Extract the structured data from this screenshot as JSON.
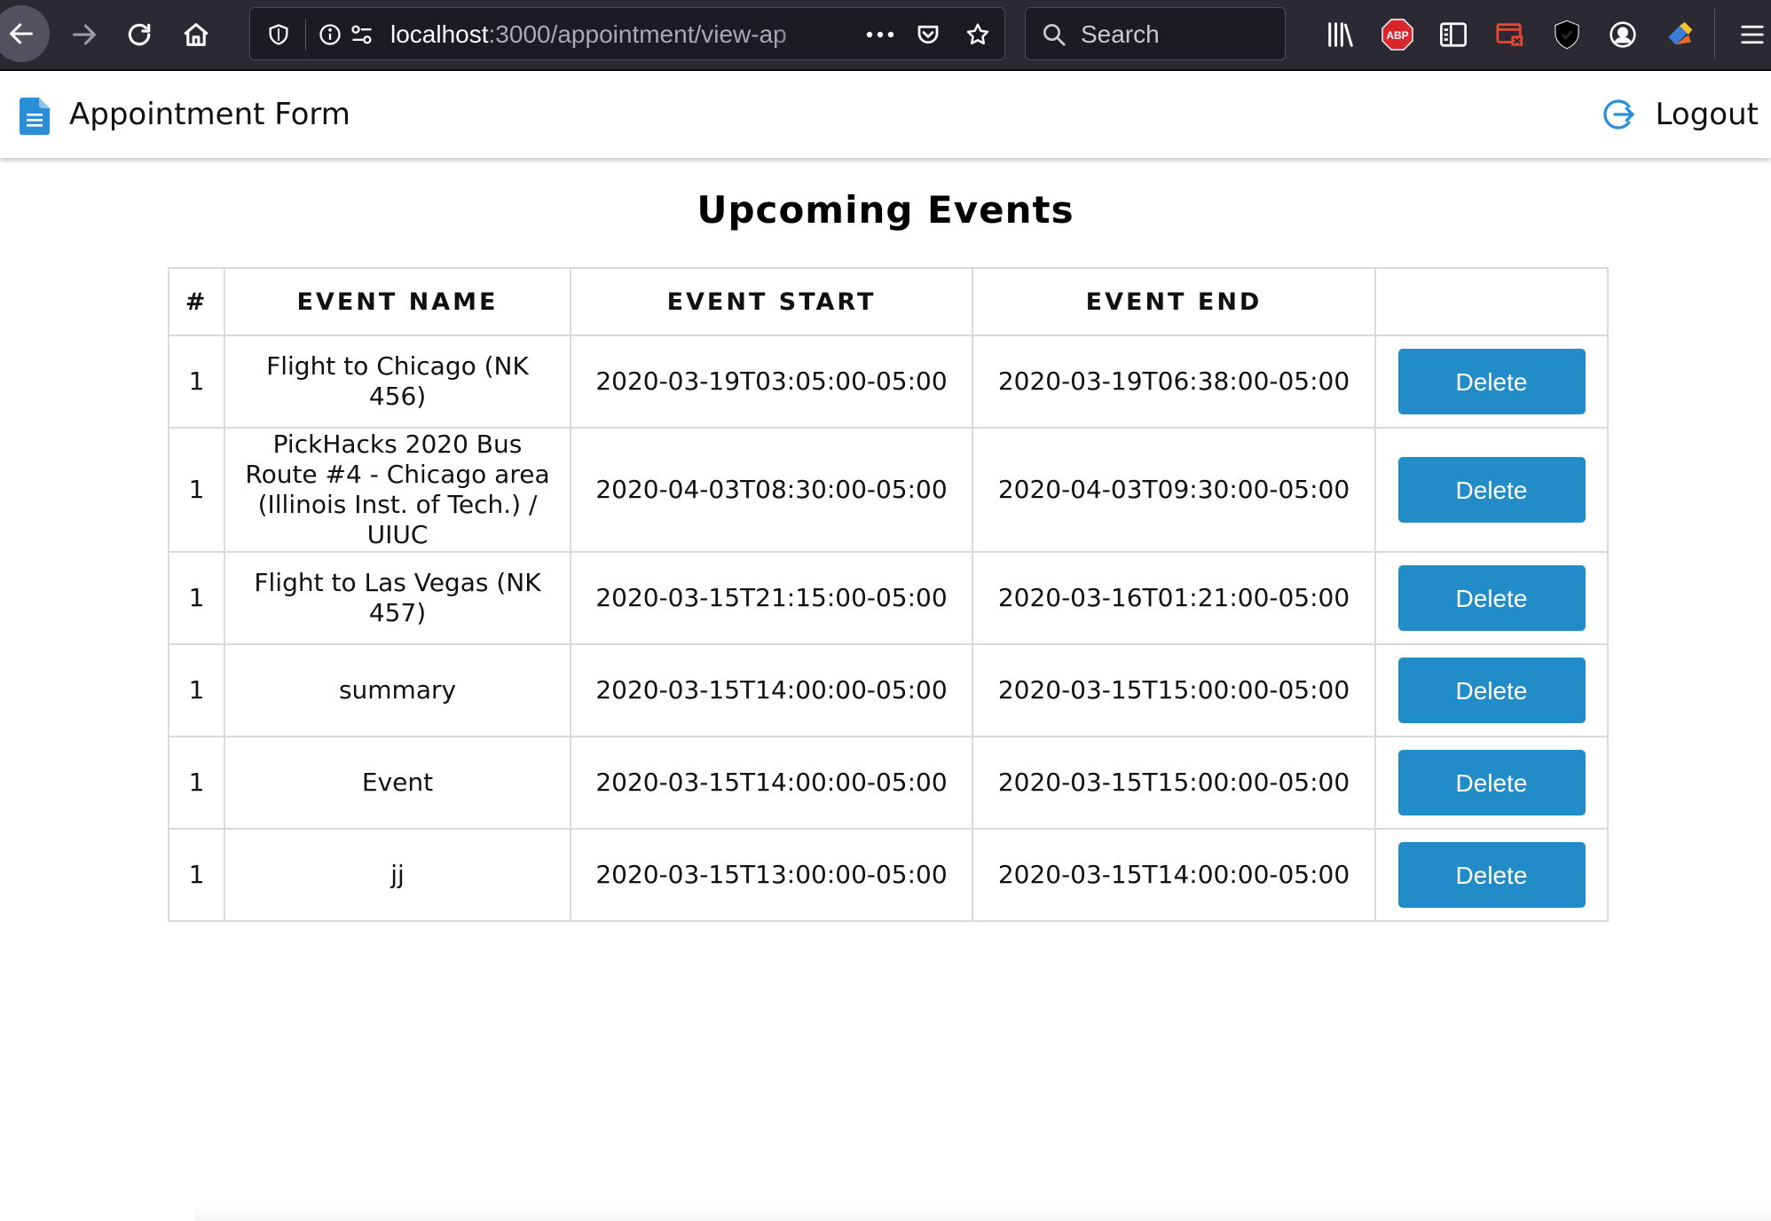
{
  "browser": {
    "url_host": "localhost",
    "url_path": ":3000/appointment/view-ap",
    "search_placeholder": "Search",
    "icons": [
      "back-arrow-icon",
      "forward-arrow-icon",
      "reload-icon",
      "home-icon",
      "shield-icon",
      "info-icon",
      "permissions-icon",
      "more-icon",
      "pocket-icon",
      "star-icon",
      "search-icon",
      "library-icon",
      "abp-icon",
      "reader-view-icon",
      "screenshot-icon",
      "ublock-icon",
      "account-icon",
      "extension-icon",
      "hamburger-menu-icon"
    ],
    "abp_label": "ABP"
  },
  "header": {
    "title": "Appointment Form",
    "logout_label": "Logout",
    "accent_color": "#2a8fd6"
  },
  "main": {
    "heading": "Upcoming Events",
    "columns": [
      "#",
      "EVENT NAME",
      "EVENT START",
      "EVENT END",
      ""
    ],
    "delete_label": "Delete",
    "button_color": "#228cc9",
    "rows": [
      {
        "num": "1",
        "name": "Flight to Chicago (NK 456)",
        "start": "2020-03-19T03:05:00-05:00",
        "end": "2020-03-19T06:38:00-05:00"
      },
      {
        "num": "1",
        "name": "PickHacks 2020 Bus Route #4 - Chicago area (Illinois Inst. of Tech.) / UIUC",
        "start": "2020-04-03T08:30:00-05:00",
        "end": "2020-04-03T09:30:00-05:00"
      },
      {
        "num": "1",
        "name": "Flight to Las Vegas (NK 457)",
        "start": "2020-03-15T21:15:00-05:00",
        "end": "2020-03-16T01:21:00-05:00"
      },
      {
        "num": "1",
        "name": "summary",
        "start": "2020-03-15T14:00:00-05:00",
        "end": "2020-03-15T15:00:00-05:00"
      },
      {
        "num": "1",
        "name": "Event",
        "start": "2020-03-15T14:00:00-05:00",
        "end": "2020-03-15T15:00:00-05:00"
      },
      {
        "num": "1",
        "name": "jj",
        "start": "2020-03-15T13:00:00-05:00",
        "end": "2020-03-15T14:00:00-05:00"
      }
    ]
  }
}
